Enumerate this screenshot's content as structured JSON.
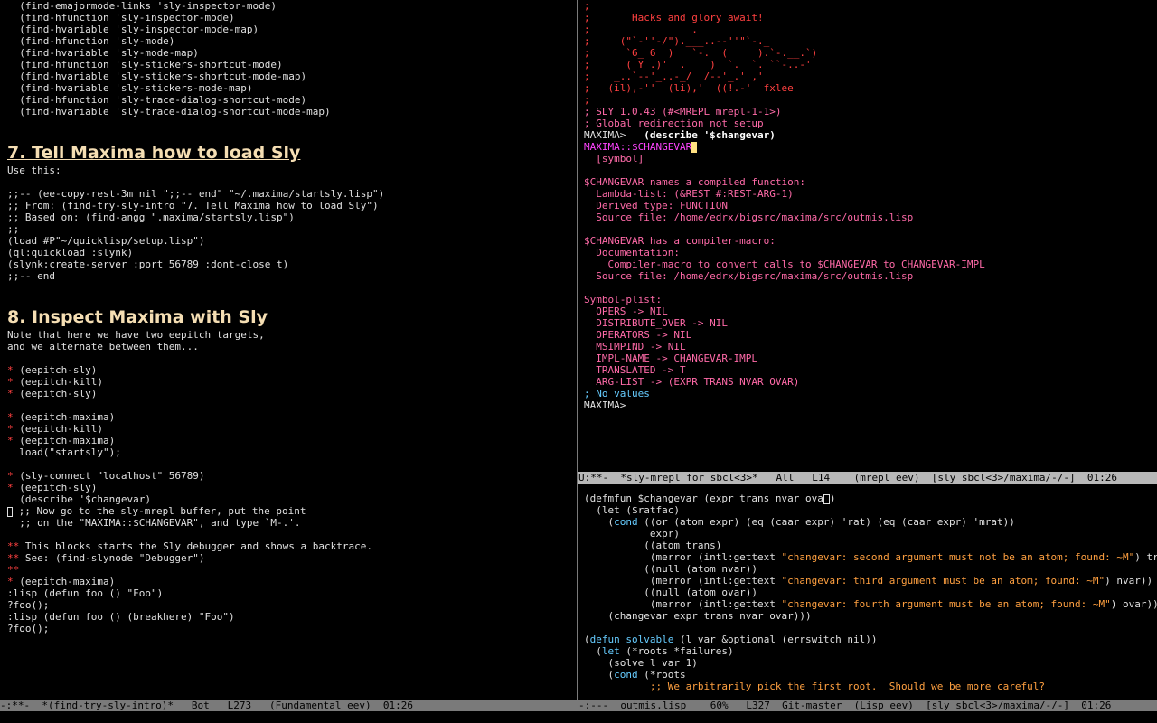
{
  "left": {
    "lines_a": [
      "  (find-emajormode-links 'sly-inspector-mode)",
      "  (find-hfunction 'sly-inspector-mode)",
      "  (find-hvariable 'sly-inspector-mode-map)",
      "  (find-hfunction 'sly-mode)",
      "  (find-hvariable 'sly-mode-map)",
      "  (find-hfunction 'sly-stickers-shortcut-mode)",
      "  (find-hvariable 'sly-stickers-shortcut-mode-map)",
      "  (find-hvariable 'sly-stickers-mode-map)",
      "  (find-hfunction 'sly-trace-dialog-shortcut-mode)",
      "  (find-hvariable 'sly-trace-dialog-shortcut-mode-map)"
    ],
    "heading7": "7. Tell Maxima how to load Sly",
    "lines_b": [
      "Use this:",
      "",
      ";;-- (ee-copy-rest-3m nil \";;-- end\" \"~/.maxima/startsly.lisp\")",
      ";; From: (find-try-sly-intro \"7. Tell Maxima how to load Sly\")",
      ";; Based on: (find-angg \".maxima/startsly.lisp\")",
      ";;",
      "(load #P\"~/quicklisp/setup.lisp\")",
      "(ql:quickload :slynk)",
      "(slynk:create-server :port 56789 :dont-close t)",
      ";;-- end"
    ],
    "heading8": "8. Inspect Maxima with Sly",
    "lines_c_intro": [
      "Note that here we have two eepitch targets,",
      "and we alternate between them..."
    ],
    "star": "*",
    "dstar": "**",
    "l_eepitch_sly": " (eepitch-sly)",
    "l_eepitch_kill": " (eepitch-kill)",
    "l_eepitch_maxima": " (eepitch-maxima)",
    "l_load_startsly": "  load(\"startsly\");",
    "l_sly_connect": " (sly-connect \"localhost\" 56789)",
    "l_describe": "  (describe '$changevar)",
    "l_now_go": " ;; Now go to the sly-mrepl buffer, put the point",
    "l_on_the": "  ;; on the \"MAXIMA::$CHANGEVAR\", and type `M-.'.",
    "l_this_blocks": " This blocks starts the Sly debugger and shows a backtrace.",
    "l_see": " See: (find-slynode \"Debugger\")",
    "l_lisp_defun_foo": ":lisp (defun foo () \"Foo\")",
    "l_foo": "?foo();",
    "l_lisp_defun_break": ":lisp (defun foo () (breakhere) \"Foo\")",
    "l_foo2": "?foo();",
    "modeline": "-:**-  *(find-try-sly-intro)*   Bot   L273   (Fundamental eev)  01:26"
  },
  "repl": {
    "banner": [
      ";",
      ";       Hacks and glory await!",
      ";                 .",
      ";     (\"`-''-/\").___..--''\"`-._",
      ";      `6_ 6  )   `-.  (     ).`-.__.`)",
      ";      (_Y_.)'  ._   )  `._ `. ``-..-'",
      ";    _..`--'_..-_/  /--'_.' ,'",
      ";   (il),-''  (li),'  ((!.-'  fxlee",
      ";"
    ],
    "version": "; SLY 1.0.43 (#<MREPL mrepl-1-1>)",
    "redirect": "; Global redirection not setup",
    "prompt": "MAXIMA>",
    "command": "   (describe '$changevar)",
    "symbol_name": "MAXIMA::$CHANGEVAR",
    "symbol_tag": "  [symbol]",
    "desc": [
      "$CHANGEVAR names a compiled function:",
      "  Lambda-list: (&REST #:REST-ARG-1)",
      "  Derived type: FUNCTION",
      "  Source file: /home/edrx/bigsrc/maxima/src/outmis.lisp",
      "",
      "$CHANGEVAR has a compiler-macro:",
      "  Documentation:",
      "    Compiler-macro to convert calls to $CHANGEVAR to CHANGEVAR-IMPL",
      "  Source file: /home/edrx/bigsrc/maxima/src/outmis.lisp",
      "",
      "Symbol-plist:",
      "  OPERS -> NIL",
      "  DISTRIBUTE_OVER -> NIL",
      "  OPERATORS -> NIL",
      "  MSIMPIND -> NIL",
      "  IMPL-NAME -> CHANGEVAR-IMPL",
      "  TRANSLATED -> T",
      "  ARG-LIST -> (EXPR TRANS NVAR OVAR)"
    ],
    "novalues": "; No values",
    "prompt2": "MAXIMA>",
    "modeline": "U:**-  *sly-mrepl for sbcl<3>*   All   L14    (mrepl eev)  [sly sbcl<3>/maxima/-/-]  01:26"
  },
  "code": {
    "l1_a": "(defmfun $changevar (expr trans nvar ova",
    "l1_b": "r",
    "l1_c": ")",
    "l2": "  (let ($ratfac)",
    "l3_cond": "cond",
    "l3_rest": " ((or (atom expr) (eq (caar expr) 'rat) (eq (caar expr) 'mrat))",
    "l4": "           expr)",
    "l5": "          ((atom trans)",
    "l6_a": "           (merror (intl:gettext ",
    "l6_s": "\"changevar: second argument must not be an atom; found: ~M\"",
    "l6_b": ") trans))",
    "l7": "          ((null (atom nvar))",
    "l8_s": "\"changevar: third argument must be an atom; found: ~M\"",
    "l8_b": ") nvar))",
    "l9": "          ((null (atom ovar))",
    "l10_s": "\"changevar: fourth argument must be an atom; found: ~M\"",
    "l10_b": ") ovar)))",
    "l11": "    (changevar expr trans nvar ovar)))",
    "l13_defun": "defun",
    "l13_name": "solvable",
    "l13_rest": " (l var &optional (errswitch nil))",
    "l14_let": "let",
    "l14_rest": " (*roots *failures)",
    "l15": "    (solve l var 1)",
    "l16_cond": "cond",
    "l16_rest": " (*roots",
    "l17": "           ;; We arbitrarily pick the first root.  Should we be more careful?",
    "modeline": "-:---  outmis.lisp    60%   L327  Git-master  (Lisp eev)  [sly sbcl<3>/maxima/-/-]  01:26"
  },
  "colors": {
    "background": "#000000",
    "heading": "#f5deb3",
    "bullet": "#ff4040",
    "repl_output": "#ff6aa8",
    "string": "#ffa040",
    "keyword": "#66ccff",
    "modeline_active": "#b8b8b8",
    "modeline_inactive": "#7a7a7a"
  }
}
